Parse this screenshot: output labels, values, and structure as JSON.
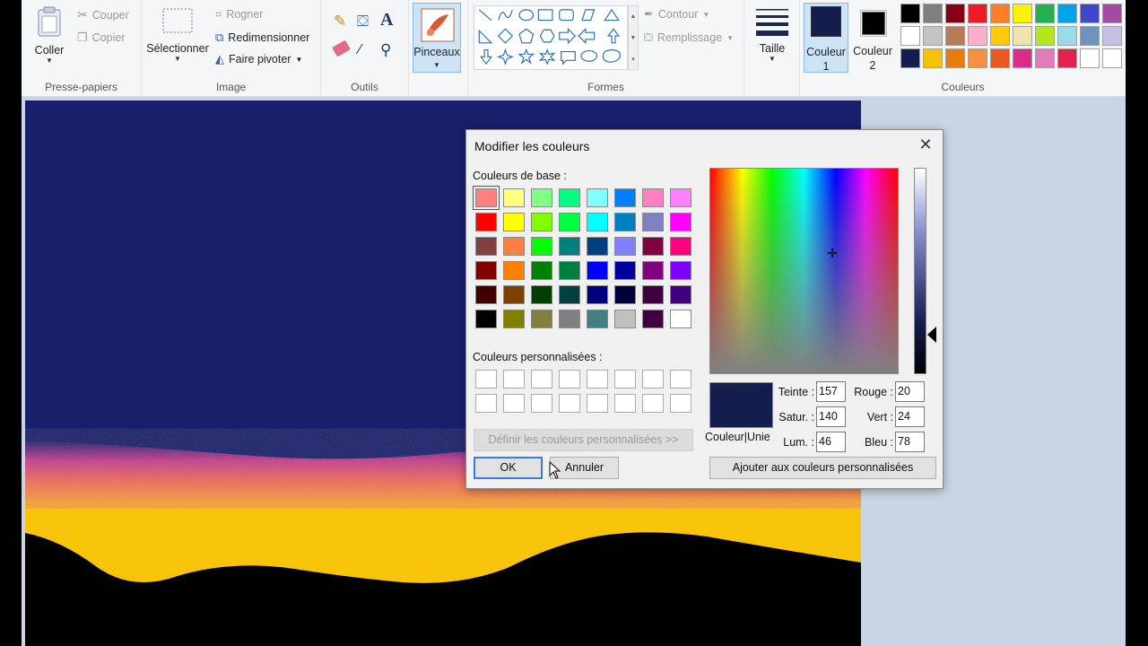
{
  "ribbon": {
    "clipboard": {
      "paste": "Coller",
      "cut": "Couper",
      "copy": "Copier",
      "label": "Presse-papiers"
    },
    "image": {
      "select": "Sélectionner",
      "crop": "Rogner",
      "resize": "Redimensionner",
      "rotate": "Faire pivoter",
      "label": "Image"
    },
    "tools": {
      "label": "Outils"
    },
    "brushes": {
      "label": "Pinceaux"
    },
    "shapes": {
      "outline": "Contour",
      "fill": "Remplissage",
      "label": "Formes"
    },
    "size": {
      "label": "Taille"
    },
    "colors": {
      "color1": "Couleur 1",
      "color1_line1": "Couleur",
      "color1_line2": "1",
      "color2_line1": "Couleur",
      "color2_line2": "2",
      "label": "Couleurs",
      "color1_value": "#141E4E",
      "color2_value": "#000000",
      "palette": [
        "#000000",
        "#7f7f7f",
        "#880015",
        "#ed1c24",
        "#ff7f27",
        "#fff200",
        "#22b14c",
        "#00a2e8",
        "#3f48cc",
        "#a349a4",
        "#ffffff",
        "#c3c3c3",
        "#b97a57",
        "#ffaec9",
        "#ffc90e",
        "#efe4b0",
        "#b5e61d",
        "#99d9ea",
        "#7092be",
        "#c8bfe7",
        "#141e4e",
        "#f8c200",
        "#e87b10",
        "#f69040",
        "#e85a20",
        "#d82e88",
        "#e07cb8",
        "#e0204e",
        "#ffffff",
        "#ffffff"
      ]
    }
  },
  "dialog": {
    "title": "Modifier les couleurs",
    "basic_label": "Couleurs de base :",
    "custom_label": "Couleurs personnalisées :",
    "define_custom": "Définir les couleurs personnalisées >>",
    "ok": "OK",
    "cancel": "Annuler",
    "add_custom": "Ajouter aux couleurs personnalisées",
    "solid_label": "Couleur|Unie",
    "hue_label": "Teinte :",
    "hue": "157",
    "sat_label": "Satur. :",
    "sat": "140",
    "lum_label": "Lum. :",
    "lum": "46",
    "red_label": "Rouge :",
    "red": "20",
    "green_label": "Vert :",
    "green": "24",
    "blue_label": "Bleu :",
    "blue": "78",
    "preview_color": "#141E4E",
    "basic_colors": [
      "#ff8080",
      "#ffff80",
      "#80ff80",
      "#00ff80",
      "#80ffff",
      "#0080ff",
      "#ff80c0",
      "#ff80ff",
      "#ff0000",
      "#ffff00",
      "#80ff00",
      "#00ff40",
      "#00ffff",
      "#0080c0",
      "#8080c0",
      "#ff00ff",
      "#804040",
      "#ff8040",
      "#00ff00",
      "#008080",
      "#004080",
      "#8080ff",
      "#800040",
      "#ff0080",
      "#800000",
      "#ff8000",
      "#008000",
      "#008040",
      "#0000ff",
      "#0000a0",
      "#800080",
      "#8000ff",
      "#400000",
      "#804000",
      "#004000",
      "#004040",
      "#000080",
      "#000040",
      "#400040",
      "#400080",
      "#000000",
      "#808000",
      "#808040",
      "#808080",
      "#408080",
      "#c0c0c0",
      "#400040",
      "#ffffff"
    ]
  }
}
